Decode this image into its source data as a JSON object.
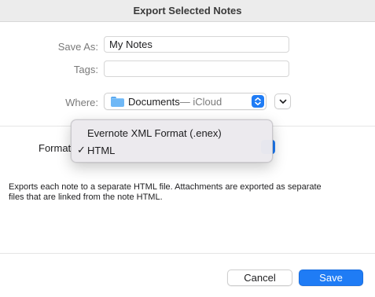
{
  "dialog": {
    "title": "Export Selected Notes"
  },
  "form": {
    "save_as_label": "Save As:",
    "save_as_value": "My Notes",
    "tags_label": "Tags:",
    "tags_value": "",
    "where_label": "Where:",
    "where_folder": "Documents",
    "where_location": " — iCloud",
    "where_icon": "folder-icon",
    "format_label": "Format"
  },
  "format_menu": {
    "items": [
      {
        "label": "Evernote XML Format (.enex)",
        "checked": false
      },
      {
        "label": "HTML",
        "checked": true
      }
    ],
    "checkmark": "✓"
  },
  "description": {
    "line1": "Exports each note to a separate HTML file.  Attachments are exported as separate",
    "line2": "files that are linked from the note HTML."
  },
  "buttons": {
    "cancel": "Cancel",
    "save": "Save"
  },
  "colors": {
    "accent": "#1f7cf5",
    "menu_background": "#eceaee"
  }
}
